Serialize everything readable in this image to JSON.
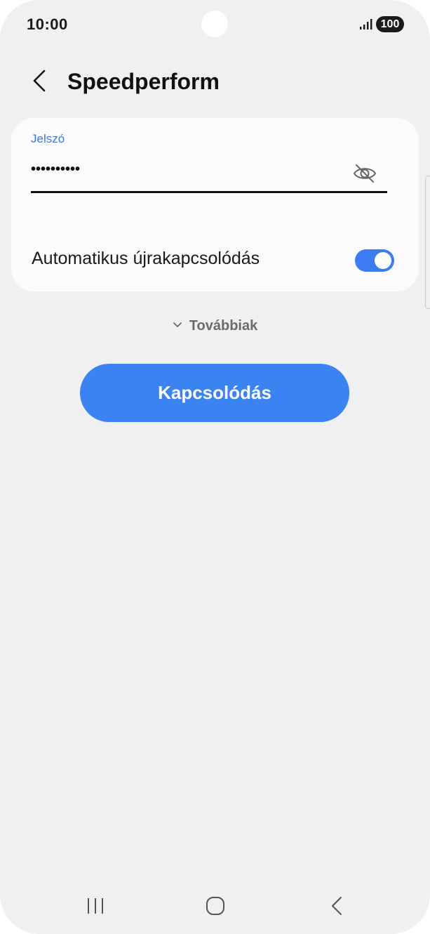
{
  "status_bar": {
    "time": "10:00",
    "battery": "100",
    "signal_icon": "signal-icon"
  },
  "header": {
    "title": "Speedperform",
    "back_icon": "chevron-left-icon"
  },
  "form": {
    "password_label": "Jelszó",
    "password_value": "••••••••••",
    "visibility_icon": "eye-off-icon",
    "auto_reconnect_label": "Automatikus újrakapcsolódás",
    "auto_reconnect_enabled": true
  },
  "more": {
    "label": "Továbbiak",
    "icon": "chevron-down-icon"
  },
  "actions": {
    "connect_label": "Kapcsolódás"
  },
  "nav": {
    "recents_icon": "recents-icon",
    "home_icon": "home-icon",
    "back_icon": "back-icon"
  },
  "colors": {
    "accent": "#3b83f1",
    "label_blue": "#3c78d8",
    "background": "#f0f0f2",
    "card": "#fbfbfd"
  }
}
